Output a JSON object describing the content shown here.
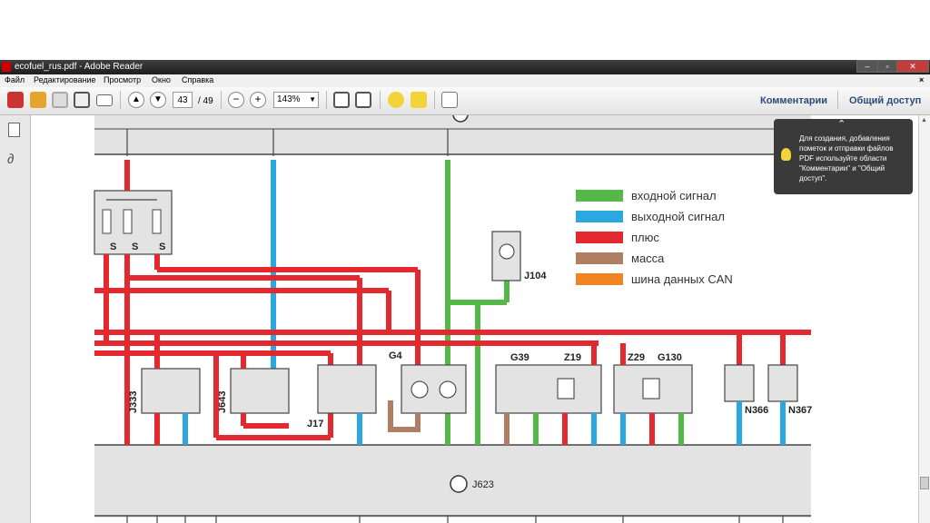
{
  "window": {
    "title": "ecofuel_rus.pdf - Adobe Reader"
  },
  "menu": [
    "Файл",
    "Редактирование",
    "Просмотр",
    "Окно",
    "Справка"
  ],
  "toolbar": {
    "page_current": "43",
    "page_total": "/ 49",
    "zoom": "143%",
    "comments_label": "Комментарии",
    "share_label": "Общий доступ"
  },
  "tooltip": {
    "text": "Для создания, добавления пометок и отправки файлов PDF используйте области \"Комментарии\" и \"Общий доступ\"."
  },
  "legend": [
    {
      "label": "входной сигнал",
      "color": "#55b848"
    },
    {
      "label": "выходной сигнал",
      "color": "#2ba8e0"
    },
    {
      "label": "плюс",
      "color": "#e4282f"
    },
    {
      "label": "масса",
      "color": "#b07e63"
    },
    {
      "label": "шина данных CAN",
      "color": "#f08526"
    }
  ],
  "diagram": {
    "fuse_labels": [
      "S",
      "S",
      "S"
    ],
    "components": {
      "j104": "J104",
      "g4": "G4",
      "g39": "G39",
      "z19": "Z19",
      "z29": "Z29",
      "g130": "G130",
      "j333": "J333",
      "j643": "J643",
      "j17": "J17",
      "n366": "N366",
      "n367": "N367",
      "j623": "J623"
    }
  },
  "colors": {
    "plus": "#e4282f",
    "input": "#55b848",
    "output": "#2ba8e0",
    "ground": "#b07e63",
    "can": "#f08526"
  }
}
